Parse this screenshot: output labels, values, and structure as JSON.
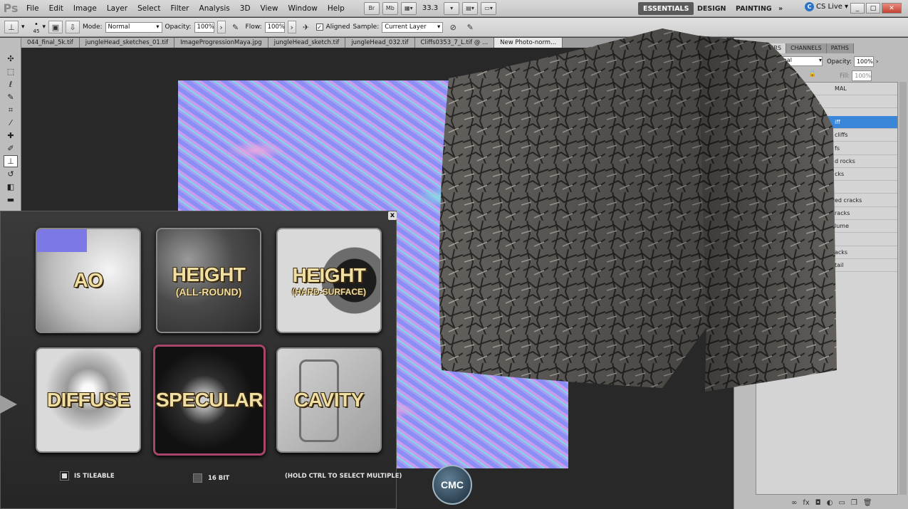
{
  "app": {
    "logo": "Ps"
  },
  "menu": [
    "File",
    "Edit",
    "Image",
    "Layer",
    "Select",
    "Filter",
    "Analysis",
    "3D",
    "View",
    "Window",
    "Help"
  ],
  "menubar_buttons": {
    "bridge": "Br",
    "mini_bridge": "Mb",
    "zoom": "33.3"
  },
  "workspaces": {
    "essentials": "ESSENTIALS",
    "design": "DESIGN",
    "painting": "PAINTING",
    "more": "»"
  },
  "cslive": {
    "label": "CS Live"
  },
  "window_controls": {
    "minimize": "_",
    "restore": "□",
    "close": "✕"
  },
  "options": {
    "brush_size": "45",
    "mode_label": "Mode:",
    "mode_value": "Normal",
    "opacity_label": "Opacity:",
    "opacity_value": "100%",
    "flow_label": "Flow:",
    "flow_value": "100%",
    "aligned_label": "Aligned",
    "sample_label": "Sample:",
    "sample_value": "Current Layer"
  },
  "doc_tabs": [
    "044_final_5k.tif",
    "jungleHead_sketches_01.tif",
    "ImageProgressionMaya.jpg",
    "jungleHead_sketch.tif",
    "jungleHead_032.tif",
    "Cliffs0353_7_L.tif @ ...",
    "New Photo-norm..."
  ],
  "toolbox": [
    "move-tool",
    "marquee-tool",
    "lasso-tool",
    "quick-select-tool",
    "crop-tool",
    "eyedropper-tool",
    "healing-tool",
    "brush-tool",
    "clone-stamp-tool",
    "history-brush-tool",
    "eraser-tool",
    "gradient-tool"
  ],
  "layers_panel": {
    "tabs": [
      "LAYERS",
      "CHANNELS",
      "PATHS"
    ],
    "blend_mode": "mal",
    "opacity_label": "Opacity:",
    "opacity_value": "100%",
    "fill_label": "Fill:",
    "fill_value": "100%",
    "rows": [
      {
        "label": "MAL",
        "selected": false
      },
      {
        "label": "",
        "selected": false
      },
      {
        "label": "iff",
        "selected": true
      },
      {
        "label": "cliffs",
        "selected": false
      },
      {
        "label": "fs",
        "selected": false
      },
      {
        "label": "d rocks",
        "selected": false
      },
      {
        "label": "cks",
        "selected": false
      },
      {
        "label": "",
        "selected": false
      },
      {
        "label": "ed cracks",
        "selected": false
      },
      {
        "label": "racks",
        "selected": false
      },
      {
        "label": "lume",
        "selected": false
      },
      {
        "label": "",
        "selected": false
      },
      {
        "label": "acks",
        "selected": false
      },
      {
        "label": "tail",
        "selected": false
      }
    ]
  },
  "dialog": {
    "close": "x",
    "tiles": [
      {
        "title": "AO",
        "subtitle": ""
      },
      {
        "title": "HEIGHT",
        "subtitle": "(ALL-ROUND)"
      },
      {
        "title": "HEIGHT",
        "subtitle": "(HARD-SURFACE)"
      },
      {
        "title": "DIFFUSE",
        "subtitle": ""
      },
      {
        "title": "SPECULAR",
        "subtitle": ""
      },
      {
        "title": "CAVITY",
        "subtitle": ""
      }
    ],
    "is_tileable": "IS TILEABLE",
    "bit16": "16 BIT",
    "hint": "(HOLD CTRL TO SELECT MULTIPLE)"
  },
  "watermark": {
    "text": "CMC"
  },
  "colors": {
    "accent": "#3a86d9",
    "tile_text": "#f0dfa3",
    "selected_tile_border": "#a8456a"
  }
}
